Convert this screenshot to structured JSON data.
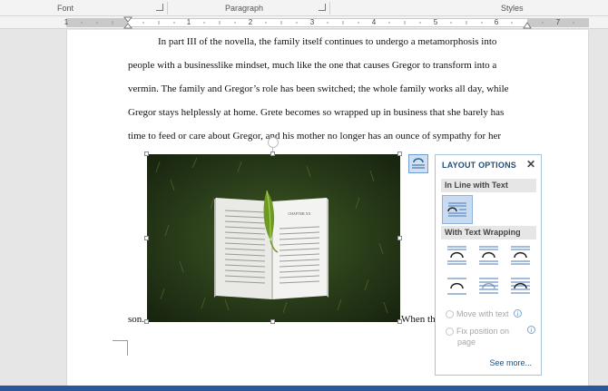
{
  "ribbon": {
    "groups": [
      "Font",
      "Paragraph",
      "Styles"
    ]
  },
  "ruler": {
    "labels": [
      "1",
      "1",
      "2",
      "3",
      "4",
      "5",
      "6",
      "7"
    ]
  },
  "document": {
    "lines": [
      "In part III of the novella, the family itself continues to undergo a metamorphosis into",
      "people with a businesslike mindset, much like the one that causes Gregor to transform into a",
      "vermin. The family and Gregor’s role has been switched; the whole family works all day, while",
      "Gregor stays helplessly at home. Grete becomes so wrapped up in business that she barely has",
      "time to feed or care about Gregor, and his mother no longer has an ounce of sympathy for her"
    ],
    "after_image_left": "son.",
    "after_image_right": "When th"
  },
  "image": {
    "book_left_heading": "",
    "book_right_heading": "CHAPTER XX"
  },
  "layout_options": {
    "title": "LAYOUT OPTIONS",
    "close": "✕",
    "inline_section": "In Line with Text",
    "wrapping_section": "With Text Wrapping",
    "move_with_text": "Move with text",
    "fix_position": "Fix position on",
    "fix_position_2": "page",
    "info": "i",
    "see_more": "See more..."
  },
  "colors": {
    "accent": "#1f4e79",
    "statusbar": "#2b579a",
    "grass": "#243518"
  }
}
